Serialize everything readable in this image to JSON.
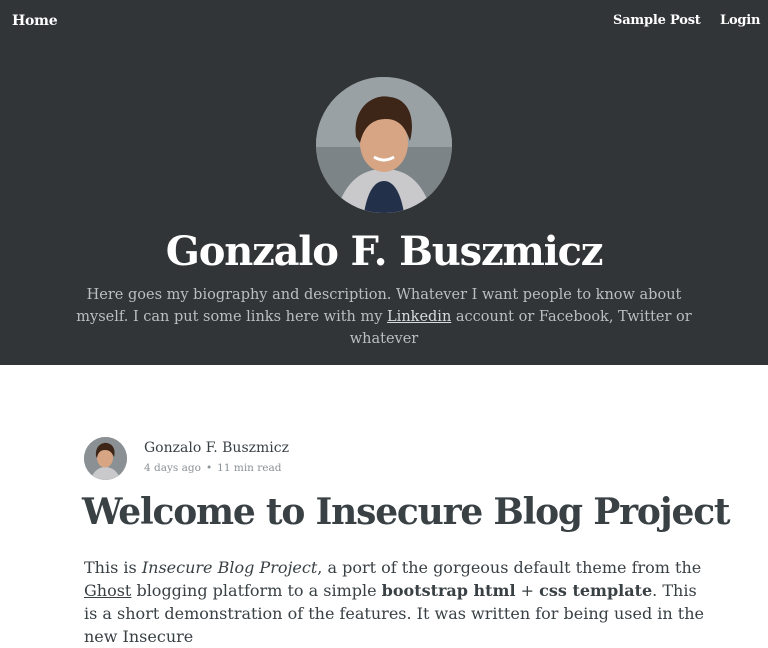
{
  "nav": {
    "home": "Home",
    "sample_post": "Sample Post",
    "login": "Login"
  },
  "hero": {
    "title": "Gonzalo F. Buszmicz",
    "bio_before": "Here goes my biography and description. Whatever I want people to know about myself. I can put some links here with my ",
    "bio_link": "Linkedin",
    "bio_after": " account or Facebook, Twitter or whatever"
  },
  "post": {
    "author": "Gonzalo F. Buszmicz",
    "date": "4 days ago",
    "separator": "•",
    "read_time": "11 min read",
    "title": "Welcome to Insecure Blog Project",
    "body": {
      "t1": "This is ",
      "em1": "Insecure Blog Project",
      "t2": ", a port of the gorgeous default theme from the ",
      "link1": "Ghost",
      "t3": " blogging platform to a simple ",
      "strong1": "bootstrap html",
      "t4": " + ",
      "strong2": "css template",
      "t5": ". This is a short demonstration of the features. It was written for being used in the new Insecure"
    }
  },
  "colors": {
    "hero_bg": "#313537",
    "text": "#3a4145",
    "meta": "#8a9296"
  }
}
